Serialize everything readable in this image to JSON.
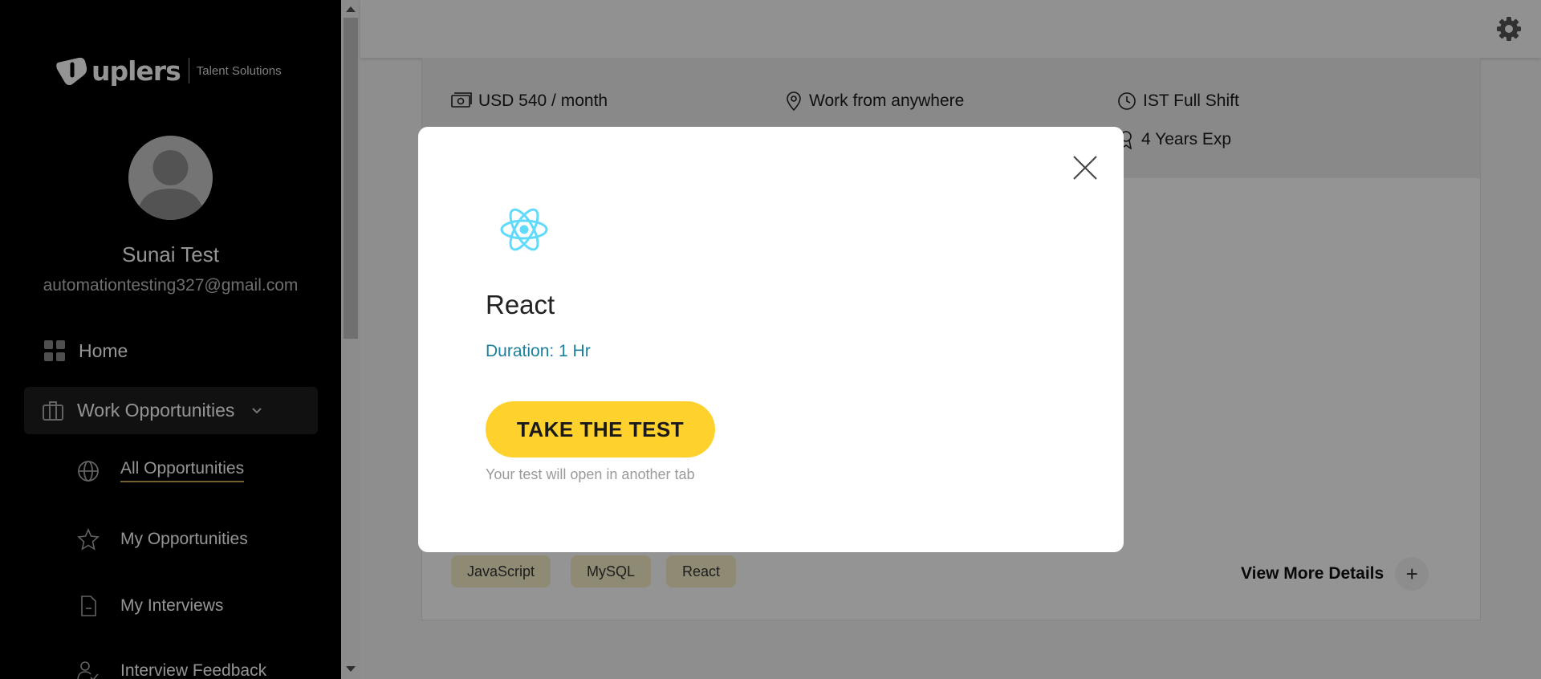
{
  "sidebar": {
    "logo_brand": "uplers",
    "logo_sub": "Talent Solutions",
    "user_name": "Sunai Test",
    "user_email": "automationtesting327@gmail.com",
    "items": {
      "home": "Home",
      "work": "Work Opportunities",
      "all": "All Opportunities",
      "my": "My Opportunities",
      "interviews": "My Interviews",
      "feedback": "Interview Feedback"
    }
  },
  "job": {
    "salary": "USD 540 / month",
    "location": "Work from anywhere",
    "shift": "IST Full Shift",
    "experience": "4 Years Exp",
    "skills": [
      "JavaScript",
      "MySQL",
      "React"
    ],
    "view_more": "View More Details"
  },
  "modal": {
    "title": "React",
    "duration": "Duration: 1 Hr",
    "button": "TAKE THE TEST",
    "note": "Your test will open in another tab"
  },
  "colors": {
    "accent_yellow": "#ffd12c",
    "duration_teal": "#1a7f9c",
    "react_blue": "#61dafb",
    "tag_bg": "#f6eec9"
  }
}
